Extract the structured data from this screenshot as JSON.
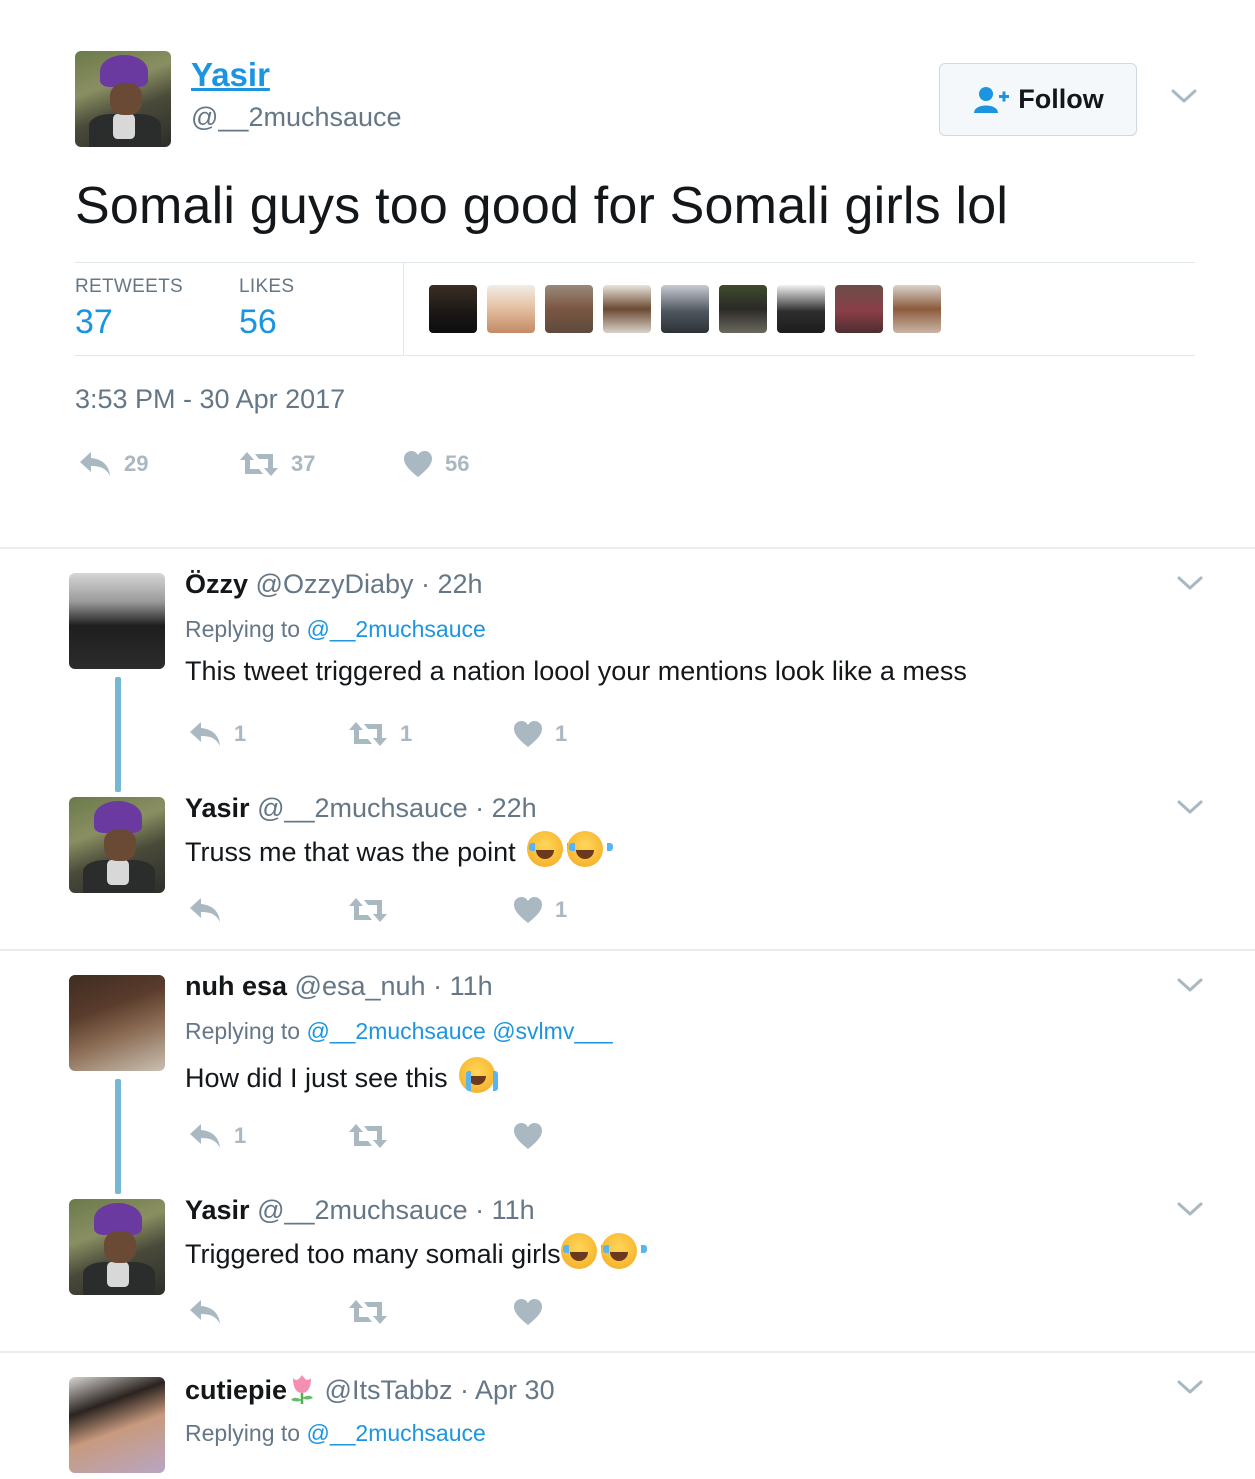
{
  "tweet": {
    "author_name": "Yasir",
    "author_handle": "@__2muchsauce",
    "follow_label": "Follow",
    "text": "Somali guys too good for Somali girls lol",
    "retweets_label": "RETWEETS",
    "retweets_count": "37",
    "likes_label": "LIKES",
    "likes_count": "56",
    "timestamp": "3:53 PM - 30 Apr 2017",
    "actions": {
      "reply_count": "29",
      "retweet_count": "37",
      "like_count": "56"
    },
    "liker_avatars": [
      "liker-avatar-1",
      "liker-avatar-2",
      "liker-avatar-3",
      "liker-avatar-4",
      "liker-avatar-5",
      "liker-avatar-6",
      "liker-avatar-7",
      "liker-avatar-8",
      "liker-avatar-9"
    ]
  },
  "replies": [
    {
      "name": "Özzy",
      "handle": "@OzzyDiaby",
      "time": "· 22h",
      "replying_prefix": "Replying to",
      "replying_to": "@__2muchsauce",
      "text": "This tweet triggered a nation loool your mentions look like a mess",
      "reply_count": "1",
      "retweet_count": "1",
      "like_count": "1"
    },
    {
      "name": "Yasir",
      "handle": "@__2muchsauce",
      "time": "· 22h",
      "text": "Truss me that was the point",
      "emojis": [
        "face-with-tears-of-joy-icon",
        "face-with-tears-of-joy-icon"
      ],
      "reply_count": "",
      "retweet_count": "",
      "like_count": "1"
    },
    {
      "name": "nuh esa",
      "handle": "@esa_nuh",
      "time": "· 11h",
      "replying_prefix": "Replying to",
      "replying_to": "@__2muchsauce @svlmv___",
      "text": "How did I just see this",
      "emojis": [
        "loudly-crying-face-icon"
      ],
      "reply_count": "1",
      "retweet_count": "",
      "like_count": ""
    },
    {
      "name": "Yasir",
      "handle": "@__2muchsauce",
      "time": "· 11h",
      "text": "Triggered too many somali girls",
      "emojis": [
        "face-with-tears-of-joy-icon",
        "face-with-tears-of-joy-icon"
      ],
      "reply_count": "",
      "retweet_count": "",
      "like_count": ""
    },
    {
      "name": "cutiepie",
      "name_emoji": "tulip-icon",
      "handle": "@ItsTabbz",
      "time": "· Apr 30",
      "replying_prefix": "Replying to",
      "replying_to": "@__2muchsauce"
    }
  ],
  "colors": {
    "link_blue": "#1b95e0",
    "muted_gray": "#657786",
    "icon_gray": "#aab8c2",
    "thread_line": "#76b7d3",
    "divider": "#e6ecf0"
  }
}
